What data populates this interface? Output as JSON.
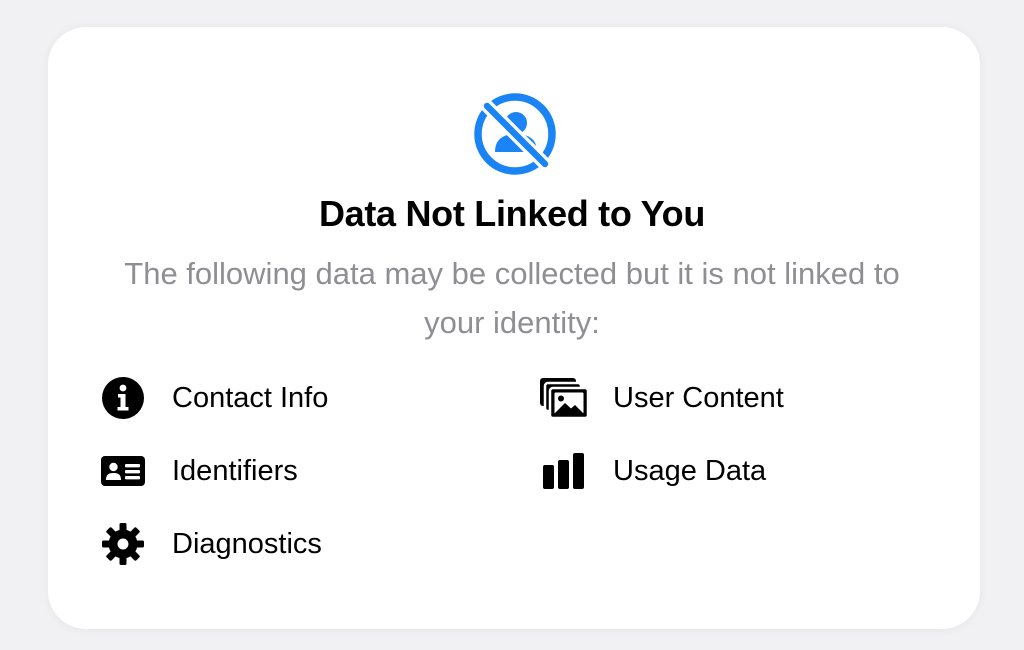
{
  "section": {
    "title": "Data Not Linked to You",
    "description": "The following data may be collected but it is not linked to your identity:",
    "icon": "person-crossed-out-icon",
    "accent_color": "#1a84f5"
  },
  "items": [
    {
      "label": "Contact Info",
      "icon": "info-circle-icon"
    },
    {
      "label": "Identifiers",
      "icon": "id-card-icon"
    },
    {
      "label": "Diagnostics",
      "icon": "gear-icon"
    },
    {
      "label": "User Content",
      "icon": "photo-stack-icon"
    },
    {
      "label": "Usage Data",
      "icon": "bar-chart-icon"
    }
  ],
  "colors": {
    "title": "#000000",
    "description": "#8e8e93",
    "card_background": "#ffffff"
  }
}
